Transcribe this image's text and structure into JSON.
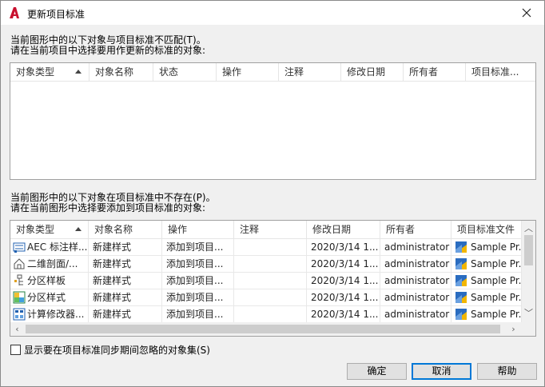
{
  "window": {
    "title": "更新项目标准",
    "close_glyph": "✕"
  },
  "top_section": {
    "line1": "当前图形中的以下对象与项目标准不匹配(T)。",
    "line2": "请在当前项目中选择要用作更新的标准的对象:",
    "columns": [
      "对象类型",
      "对象名称",
      "状态",
      "操作",
      "注释",
      "修改日期",
      "所有者",
      "项目标准..."
    ],
    "rows": []
  },
  "bottom_section": {
    "line1": "当前图形中的以下对象在项目标准中不存在(P)。",
    "line2": "请在当前图形中选择要添加到项目标准的对象:",
    "columns": [
      "对象类型",
      "对象名称",
      "操作",
      "注释",
      "修改日期",
      "所有者",
      "项目标准文件"
    ],
    "rows": [
      {
        "type": "AEC 标注样...",
        "icon": "dimension-style-icon",
        "name": "新建样式",
        "action": "添加到项目...",
        "note": "",
        "date": "2020/3/14 1...",
        "owner": "administrator",
        "file": "Sample Pr..."
      },
      {
        "type": "二维剖面/...",
        "icon": "section-elevation-icon",
        "name": "新建样式",
        "action": "添加到项目...",
        "note": "",
        "date": "2020/3/14 1...",
        "owner": "administrator",
        "file": "Sample Pr..."
      },
      {
        "type": "分区样板",
        "icon": "zone-template-icon",
        "name": "新建样式",
        "action": "添加到项目...",
        "note": "",
        "date": "2020/3/14 1...",
        "owner": "administrator",
        "file": "Sample Pr..."
      },
      {
        "type": "分区样式",
        "icon": "zone-style-icon",
        "name": "新建样式",
        "action": "添加到项目...",
        "note": "",
        "date": "2020/3/14 1...",
        "owner": "administrator",
        "file": "Sample Pr..."
      },
      {
        "type": "计算修改器...",
        "icon": "calc-modifier-icon",
        "name": "新建样式",
        "action": "添加到项目...",
        "note": "",
        "date": "2020/3/14 1...",
        "owner": "administrator",
        "file": "Sample Pr..."
      }
    ]
  },
  "checkbox": {
    "label": "显示要在项目标准同步期间忽略的对象集(S)",
    "checked": false
  },
  "buttons": {
    "ok": "确定",
    "cancel": "取消",
    "help": "帮助"
  },
  "colors": {
    "accent": "#0078d7",
    "app_icon": "#c8102e"
  }
}
